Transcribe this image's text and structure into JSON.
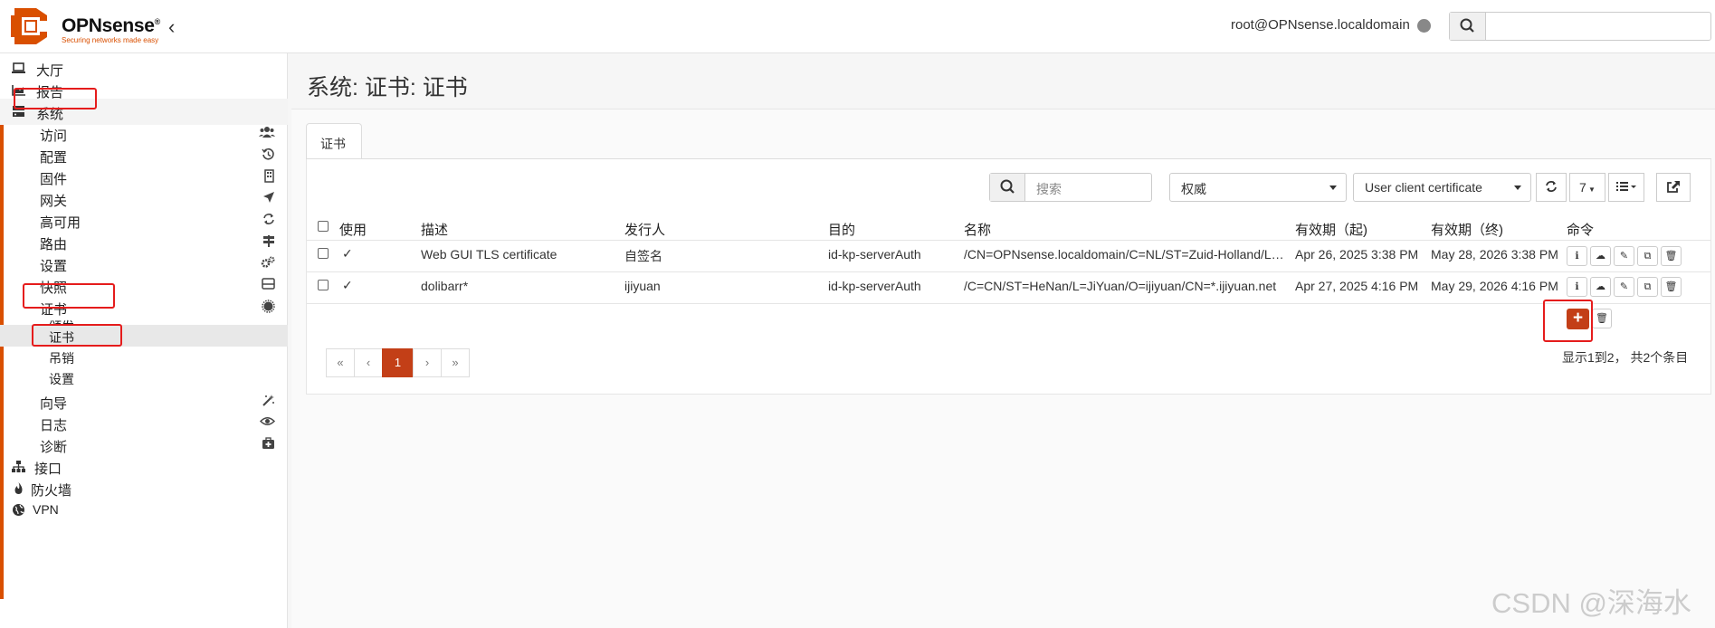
{
  "brand": {
    "name": "OPNsense",
    "reg": "®",
    "tagline": "Securing networks made easy",
    "accent": "#d94f00",
    "button_accent": "#c33f17"
  },
  "header": {
    "user": "root@OPNsense.localdomain",
    "collapse_icon": "chevron-left-icon",
    "search_icon": "search-icon"
  },
  "sidebar": {
    "top": [
      {
        "label": "大厅",
        "icon": "laptop-icon"
      },
      {
        "label": "报告",
        "icon": "area-chart-icon"
      },
      {
        "label": "系统",
        "icon": "server-icon"
      }
    ],
    "system": [
      {
        "label": "访问",
        "icon": "users-icon"
      },
      {
        "label": "配置",
        "icon": "history-icon"
      },
      {
        "label": "固件",
        "icon": "building-icon"
      },
      {
        "label": "网关",
        "icon": "location-arrow-icon"
      },
      {
        "label": "高可用",
        "icon": "refresh-icon"
      },
      {
        "label": "路由",
        "icon": "map-signs-icon"
      },
      {
        "label": "设置",
        "icon": "cogs-icon"
      },
      {
        "label": "快照",
        "icon": "hdd-icon"
      },
      {
        "label": "证书",
        "icon": "certificate-icon"
      }
    ],
    "certs": [
      "颁发",
      "证书",
      "吊销",
      "设置"
    ],
    "system_after": [
      {
        "label": "向导",
        "icon": "magic-icon"
      },
      {
        "label": "日志",
        "icon": "eye-icon"
      },
      {
        "label": "诊断",
        "icon": "medkit-icon"
      }
    ],
    "bottom": [
      {
        "label": "接口",
        "icon": "sitemap-icon"
      },
      {
        "label": "防火墙",
        "icon": "fire-icon"
      },
      {
        "label": "VPN",
        "icon": "globe-icon"
      }
    ]
  },
  "page": {
    "title": "系统: 证书: 证书",
    "tab": "证书"
  },
  "toolbar": {
    "search_placeholder": "搜索",
    "authority_select": "权威",
    "type_select": "User client certificate",
    "rows_per_page": "7",
    "refresh_icon": "refresh-icon",
    "columns_icon": "list-icon",
    "export_icon": "share-square-icon"
  },
  "table": {
    "headers": [
      "使用",
      "描述",
      "发行人",
      "目的",
      "名称",
      "有效期（起)",
      "有效期（终)",
      "命令"
    ],
    "rows": [
      {
        "description": "Web GUI TLS certificate",
        "issuer": "自签名",
        "purpose": "id-kp-serverAuth",
        "name": "/CN=OPNsense.localdomain/C=NL/ST=Zuid-Holland/L…",
        "valid_from": "Apr 26, 2025 3:38 PM",
        "valid_to": "May 28, 2026 3:38 PM"
      },
      {
        "description": "dolibarr*",
        "issuer": "ijiyuan",
        "purpose": "id-kp-serverAuth",
        "name": "/C=CN/ST=HeNan/L=JiYuan/O=ijiyuan/CN=*.ijiyuan.net",
        "valid_from": "Apr 27, 2025 4:16 PM",
        "valid_to": "May 29, 2026 4:16 PM"
      }
    ],
    "command_icons": [
      "info-icon",
      "download-icon",
      "pencil-icon",
      "copy-icon",
      "trash-icon"
    ]
  },
  "pagination": {
    "first": "«",
    "prev": "‹",
    "current": "1",
    "next": "›",
    "last": "»",
    "info": "显示1到2， 共2个条目"
  },
  "watermark": "CSDN @深海水"
}
